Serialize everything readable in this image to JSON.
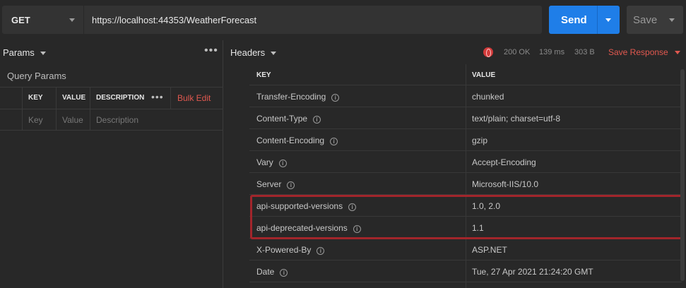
{
  "request": {
    "method": "GET",
    "url": "https://localhost:44353/WeatherForecast",
    "send_label": "Send",
    "save_label": "Save"
  },
  "params": {
    "tab_label": "Params",
    "section_title": "Query Params",
    "columns": [
      "KEY",
      "VALUE",
      "DESCRIPTION"
    ],
    "bulk_edit_label": "Bulk Edit",
    "placeholders": {
      "key": "Key",
      "value": "Value",
      "description": "Description"
    }
  },
  "response": {
    "tab_label": "Headers",
    "status": "200 OK",
    "time": "139 ms",
    "size": "303 B",
    "save_response_label": "Save Response",
    "columns": {
      "key": "KEY",
      "value": "VALUE"
    },
    "headers": [
      {
        "key": "Transfer-Encoding",
        "value": "chunked"
      },
      {
        "key": "Content-Type",
        "value": "text/plain; charset=utf-8"
      },
      {
        "key": "Content-Encoding",
        "value": "gzip"
      },
      {
        "key": "Vary",
        "value": "Accept-Encoding"
      },
      {
        "key": "Server",
        "value": "Microsoft-IIS/10.0"
      },
      {
        "key": "api-supported-versions",
        "value": "1.0, 2.0"
      },
      {
        "key": "api-deprecated-versions",
        "value": "1.1"
      },
      {
        "key": "X-Powered-By",
        "value": "ASP.NET"
      },
      {
        "key": "Date",
        "value": "Tue, 27 Apr 2021 21:24:20 GMT"
      }
    ]
  },
  "colors": {
    "accent": "#1f7ee8",
    "highlight_border": "#a2252b",
    "link": "#e0584f",
    "background": "#282828"
  },
  "icons": {
    "method_dropdown": "chevron-down-icon",
    "more": "more-horizontal-icon",
    "info": "info-icon",
    "globe": "globe-icon"
  }
}
